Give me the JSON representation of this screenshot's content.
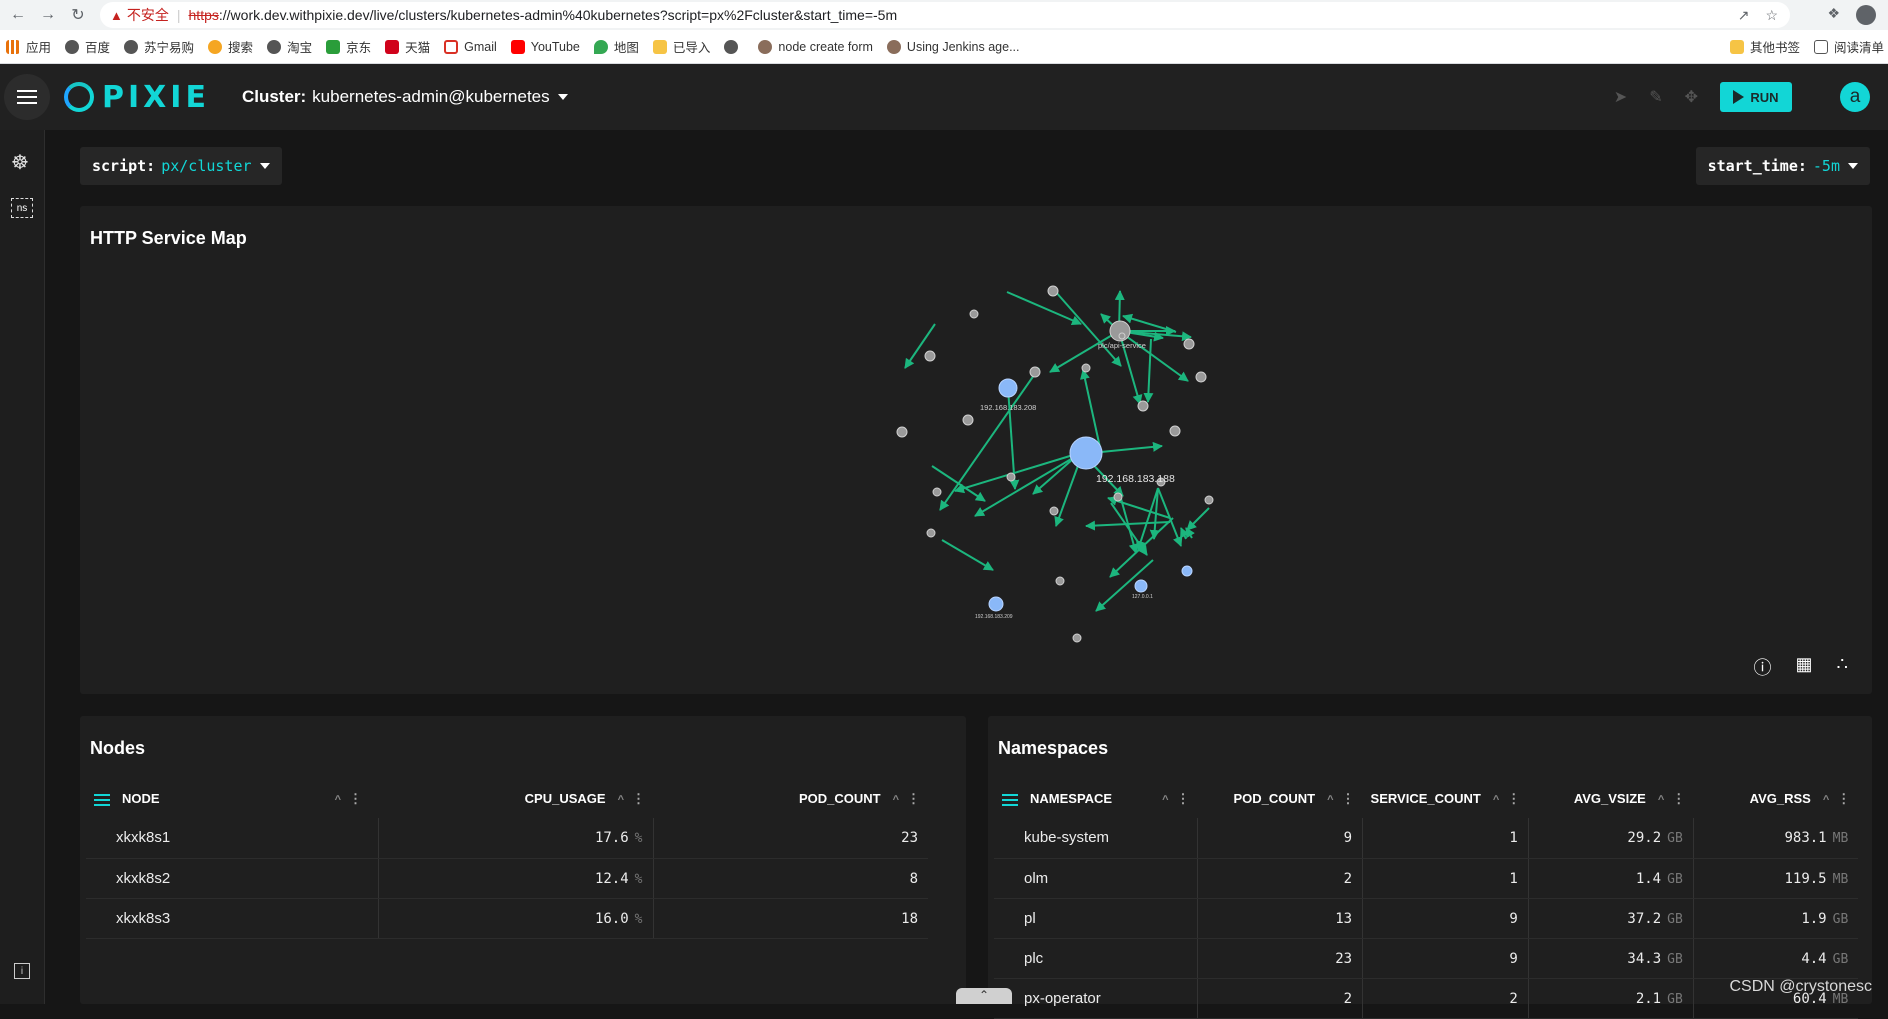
{
  "browser": {
    "insecure_label": "不安全",
    "url_scheme": "https",
    "url_rest": "://work.dev.withpixie.dev/live/clusters/kubernetes-admin%40kubernetes?script=px%2Fcluster&start_time=-5m",
    "bookmarks": [
      "应用",
      "百度",
      "苏宁易购",
      "搜索",
      "淘宝",
      "京东",
      "天猫",
      "Gmail",
      "YouTube",
      "地图",
      "已导入",
      "",
      "node create form",
      "Using Jenkins age..."
    ],
    "bookmarks_right": [
      "其他书签",
      "阅读清单"
    ]
  },
  "header": {
    "logo_text": "PIXIE",
    "cluster_key": "Cluster:",
    "cluster_value": "kubernetes-admin@kubernetes",
    "run_label": "RUN",
    "avatar_letter": "a"
  },
  "left_rail": {
    "ns_label": "ns",
    "info_label": "i"
  },
  "script": {
    "key": "script:",
    "value": "px/cluster"
  },
  "start_time": {
    "key": "start_time:",
    "value": "-5m"
  },
  "service_map": {
    "title": "HTTP Service Map",
    "labels": {
      "api_service": "plc/api-service",
      "ip_big": "192.168.183.188",
      "ip_mid": "192.168.183.208",
      "ip_low": "192.168.183.209",
      "localhost": "127.0.0.1"
    }
  },
  "nodes": {
    "title": "Nodes",
    "columns": [
      "NODE",
      "CPU_USAGE",
      "POD_COUNT"
    ],
    "rows": [
      {
        "node": "xkxk8s1",
        "cpu": "17.6",
        "unit": "%",
        "pods": "23"
      },
      {
        "node": "xkxk8s2",
        "cpu": "12.4",
        "unit": "%",
        "pods": "8"
      },
      {
        "node": "xkxk8s3",
        "cpu": "16.0",
        "unit": "%",
        "pods": "18"
      }
    ]
  },
  "namespaces": {
    "title": "Namespaces",
    "columns": [
      "NAMESPACE",
      "POD_COUNT",
      "SERVICE_COUNT",
      "AVG_VSIZE",
      "AVG_RSS"
    ],
    "rows": [
      {
        "ns": "kube-system",
        "pods": "9",
        "svcs": "1",
        "vsize": "29.2",
        "vunit": "GB",
        "rss": "983.1",
        "runit": "MB"
      },
      {
        "ns": "olm",
        "pods": "2",
        "svcs": "1",
        "vsize": "1.4",
        "vunit": "GB",
        "rss": "119.5",
        "runit": "MB"
      },
      {
        "ns": "pl",
        "pods": "13",
        "svcs": "9",
        "vsize": "37.2",
        "vunit": "GB",
        "rss": "1.9",
        "runit": "GB"
      },
      {
        "ns": "plc",
        "pods": "23",
        "svcs": "9",
        "vsize": "34.3",
        "vunit": "GB",
        "rss": "4.4",
        "runit": "GB"
      },
      {
        "ns": "px-operator",
        "pods": "2",
        "svcs": "2",
        "vsize": "2.1",
        "vunit": "GB",
        "rss": "60.4",
        "runit": "MB"
      }
    ]
  },
  "watermark": "CSDN @crystonesc",
  "colors": {
    "accent": "#12d6d6",
    "edge": "#1cb67e",
    "ip_node": "#8ab8f8",
    "svc_node": "#9a9a9a"
  }
}
